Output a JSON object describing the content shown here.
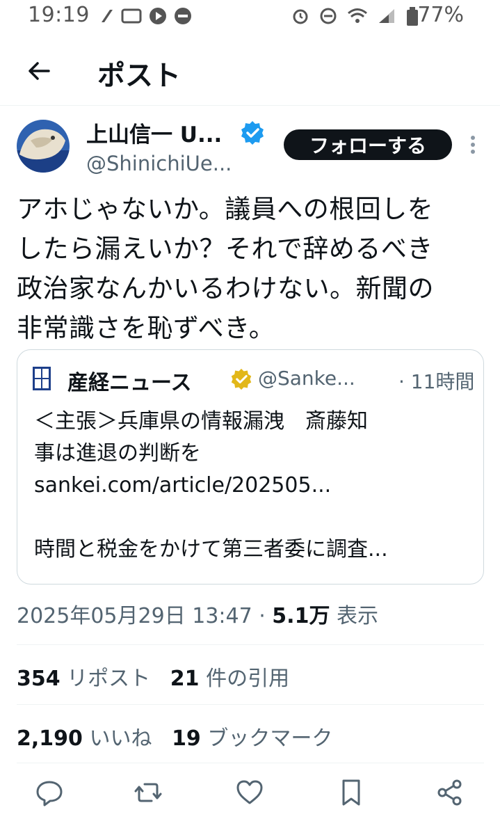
{
  "status_bar": {
    "time": "19:19",
    "battery": "77%"
  },
  "header": {
    "title": "ポスト"
  },
  "tweet": {
    "author_name": "上山信一 U...",
    "handle": "@ShinichiUe...",
    "follow_label": "フォローする",
    "text": "アホじゃないか。議員への根回しを\nしたら漏えいか？それで辞めるべき\n政治家なんかいるわけない。新聞の\n非常識さを恥ずべき。",
    "timestamp": "2025年05月29日 13:47 · ",
    "views_count": "5.1万",
    "views_label": " 表示"
  },
  "quote": {
    "name": "産経ニュース",
    "handle": "@Sanke...",
    "time": "· 11時間",
    "text": "＜主張＞兵庫県の情報漏洩　斎藤知\n事は進退の判断を\nsankei.com/article/202505...\n\n時間と税金をかけて第三者委に調査..."
  },
  "stats": {
    "reposts_count": "354",
    "reposts_label": " リポスト",
    "quotes_count": "21",
    "quotes_label": " 件の引用",
    "likes_count": "2,190",
    "likes_label": " いいね",
    "bookmarks_count": "19",
    "bookmarks_label": " ブックマーク"
  },
  "icons": {
    "back": "arrow-left-icon",
    "verified": "verified-badge-icon",
    "more": "more-vertical-icon",
    "reply": "reply-icon",
    "repost": "repost-icon",
    "like": "like-icon",
    "bookmark": "bookmark-icon",
    "share": "share-icon"
  },
  "colors": {
    "verified_blue": "#1d9bf0",
    "gold_badge": "#e2b719",
    "text_primary": "#0f1419",
    "text_secondary": "#536471"
  }
}
